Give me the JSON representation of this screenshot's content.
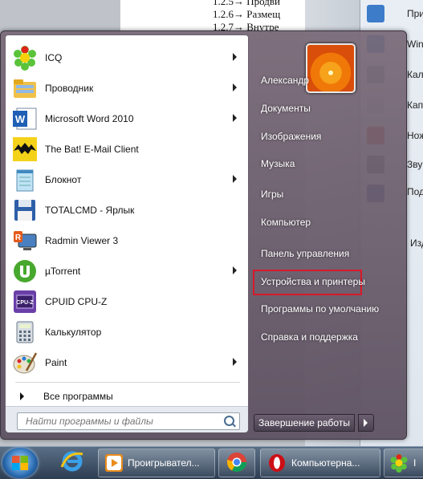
{
  "background": {
    "doc_lines": [
      "1.2.5→ Продви",
      "1.2.6→ Размещ",
      "1.2.7→ Внутре"
    ],
    "right_window_items": [
      "При",
      "Wind",
      "Кал",
      "Капи",
      "Нож",
      "Зву",
      "Под",
      "Изд"
    ]
  },
  "start_menu": {
    "programs": [
      {
        "label": "ICQ",
        "icon": "icq-flower-icon",
        "has_submenu": true
      },
      {
        "label": "Проводник",
        "icon": "explorer-folder-icon",
        "has_submenu": true
      },
      {
        "label": "Microsoft Word 2010",
        "icon": "word-icon",
        "has_submenu": true
      },
      {
        "label": "The Bat! E-Mail Client",
        "icon": "bat-icon",
        "has_submenu": false
      },
      {
        "label": "Блокнот",
        "icon": "notepad-icon",
        "has_submenu": true
      },
      {
        "label": "TOTALCMD - Ярлык",
        "icon": "floppy-disk-icon",
        "has_submenu": false
      },
      {
        "label": "Radmin Viewer 3",
        "icon": "radmin-icon",
        "has_submenu": false
      },
      {
        "label": "µTorrent",
        "icon": "utorrent-icon",
        "has_submenu": true
      },
      {
        "label": "CPUID CPU-Z",
        "icon": "cpuz-icon",
        "has_submenu": false
      },
      {
        "label": "Калькулятор",
        "icon": "calculator-icon",
        "has_submenu": false
      },
      {
        "label": "Paint",
        "icon": "paint-palette-icon",
        "has_submenu": true
      }
    ],
    "all_programs": "Все программы",
    "search_placeholder": "Найти программы и файлы",
    "right_links": [
      "Александр",
      "Документы",
      "Изображения",
      "Музыка",
      "Игры",
      "Компьютер",
      "Панель управления",
      "Устройства и принтеры",
      "Программы по умолчанию",
      "Справка и поддержка"
    ],
    "highlighted_link": "Панель управления",
    "highlight_color": "#d8192a",
    "shutdown_label": "Завершение работы"
  },
  "taskbar": {
    "items": [
      {
        "label": "",
        "icon": "internet-explorer-icon"
      },
      {
        "label": "Проигрывател...",
        "icon": "media-player-icon"
      },
      {
        "label": "",
        "icon": "chrome-icon"
      },
      {
        "label": "Компьютерна...",
        "icon": "opera-icon"
      },
      {
        "label": "I",
        "icon": "icq-flower-icon"
      }
    ]
  }
}
